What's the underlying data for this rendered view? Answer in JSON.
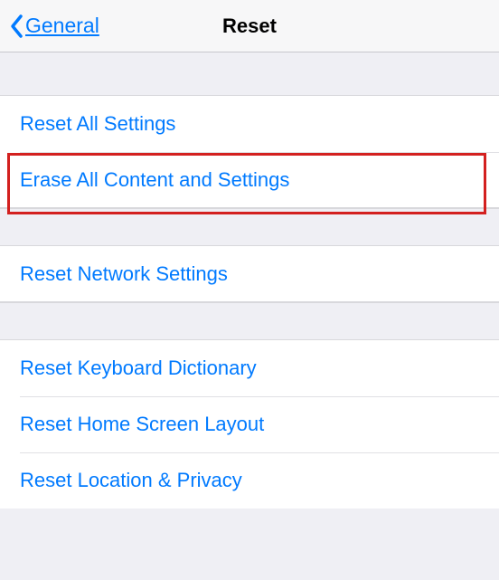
{
  "nav": {
    "back_label": "General",
    "title": "Reset"
  },
  "groups": [
    {
      "items": [
        {
          "label": "Reset All Settings",
          "name": "reset-all-settings-row"
        },
        {
          "label": "Erase All Content and Settings",
          "name": "erase-all-content-row",
          "highlighted": true
        }
      ]
    },
    {
      "items": [
        {
          "label": "Reset Network Settings",
          "name": "reset-network-settings-row"
        }
      ]
    },
    {
      "items": [
        {
          "label": "Reset Keyboard Dictionary",
          "name": "reset-keyboard-dictionary-row"
        },
        {
          "label": "Reset Home Screen Layout",
          "name": "reset-home-screen-layout-row"
        },
        {
          "label": "Reset Location & Privacy",
          "name": "reset-location-privacy-row"
        }
      ]
    }
  ],
  "colors": {
    "link": "#007aff",
    "highlight_border": "#d3201f"
  }
}
